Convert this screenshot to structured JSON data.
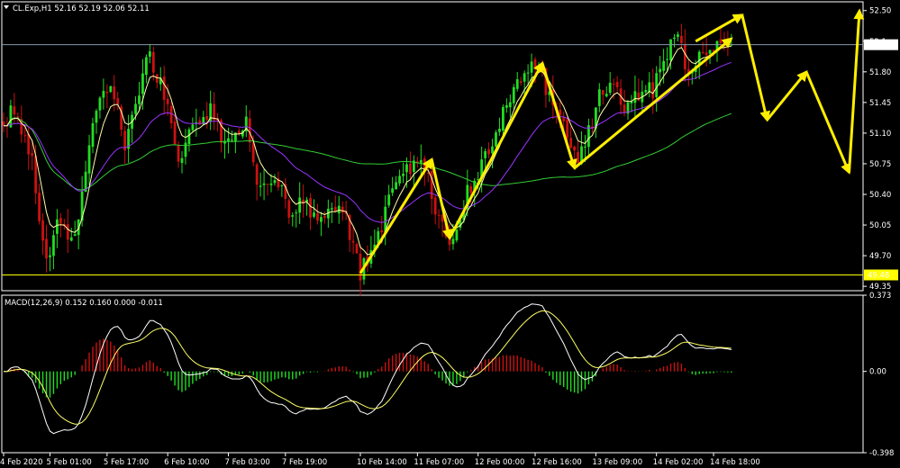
{
  "header": {
    "symbol": "CL.Exp,H1",
    "ohlc": "52.16 52.19 52.06 52.11",
    "macd_label": "MACD(12,26,9) 0.152 0.160 0.000 -0.011"
  },
  "price_axis": {
    "ticks": [
      52.5,
      52.15,
      51.8,
      51.45,
      51.1,
      50.75,
      50.4,
      50.05,
      49.7,
      49.35
    ],
    "tick_labels": [
      "52.50",
      "52.1",
      "51.80",
      "51.45",
      "51.10",
      "50.75",
      "50.40",
      "50.05",
      "49.70",
      "49.35"
    ],
    "current_price": 52.11,
    "current_label": "52.11",
    "support_price": 49.48,
    "support_label": "49.48",
    "ylim": [
      49.3,
      52.6
    ]
  },
  "macd_axis": {
    "ticks": [
      0.373,
      0.0,
      -0.398
    ],
    "tick_labels": [
      "0.373",
      "0.00",
      "-0.398"
    ],
    "ylim": [
      -0.398,
      0.373
    ]
  },
  "time_axis": {
    "labels": [
      "4 Feb 2020",
      "5 Feb 01:00",
      "5 Feb 17:00",
      "6 Feb 10:00",
      "7 Feb 03:00",
      "7 Feb 19:00",
      "10 Feb 14:00",
      "11 Feb 07:00",
      "12 Feb 00:00",
      "12 Feb 16:00",
      "13 Feb 09:00",
      "14 Feb 02:00",
      "14 Feb 18:00"
    ],
    "label_bars": [
      0,
      13,
      29,
      46,
      63,
      79,
      100,
      116,
      133,
      149,
      166,
      183,
      199
    ]
  },
  "colors": {
    "bull": "#22dd22",
    "bear": "#cc1111",
    "ma_fast": "#ffffaa",
    "ma_mid": "#9933ff",
    "ma_slow": "#33cc33",
    "macd_line": "#ffffff",
    "signal_line": "#ffff66",
    "arrows": "#ffee00",
    "support": "#ffff00",
    "current_line": "#8899aa"
  },
  "chart_data": {
    "type": "candlestick",
    "timeframe": "H1",
    "bars": 205,
    "anchors": [
      [
        0,
        51.2
      ],
      [
        3,
        51.4
      ],
      [
        8,
        50.8
      ],
      [
        12,
        49.6
      ],
      [
        15,
        50.1
      ],
      [
        20,
        49.9
      ],
      [
        25,
        51.2
      ],
      [
        30,
        51.7
      ],
      [
        34,
        51.0
      ],
      [
        38,
        51.6
      ],
      [
        41,
        52.0
      ],
      [
        46,
        51.4
      ],
      [
        49,
        50.8
      ],
      [
        54,
        51.2
      ],
      [
        58,
        51.4
      ],
      [
        62,
        51.0
      ],
      [
        68,
        51.2
      ],
      [
        72,
        50.4
      ],
      [
        76,
        50.6
      ],
      [
        80,
        50.2
      ],
      [
        84,
        50.4
      ],
      [
        88,
        50.0
      ],
      [
        92,
        50.3
      ],
      [
        96,
        50.1
      ],
      [
        100,
        49.5
      ],
      [
        104,
        49.8
      ],
      [
        108,
        50.3
      ],
      [
        112,
        50.6
      ],
      [
        117,
        50.9
      ],
      [
        122,
        50.1
      ],
      [
        125,
        49.9
      ],
      [
        128,
        50.2
      ],
      [
        132,
        50.6
      ],
      [
        136,
        50.9
      ],
      [
        141,
        51.4
      ],
      [
        146,
        51.8
      ],
      [
        150,
        51.9
      ],
      [
        153,
        51.5
      ],
      [
        157,
        51.2
      ],
      [
        160,
        50.8
      ],
      [
        163,
        51.0
      ],
      [
        167,
        51.5
      ],
      [
        170,
        51.7
      ],
      [
        174,
        51.4
      ],
      [
        178,
        51.5
      ],
      [
        182,
        51.6
      ],
      [
        186,
        52.0
      ],
      [
        189,
        52.2
      ],
      [
        192,
        51.8
      ],
      [
        196,
        52.1
      ],
      [
        201,
        52.05
      ],
      [
        205,
        52.11
      ]
    ],
    "forecast_path": [
      [
        194,
        52.15
      ],
      [
        207,
        52.45
      ],
      [
        214,
        51.25
      ],
      [
        225,
        51.8
      ],
      [
        237,
        50.65
      ],
      [
        250,
        52.5
      ]
    ],
    "trend_arrows": [
      [
        [
          100,
          49.5
        ],
        [
          120,
          50.8
        ]
      ],
      [
        [
          120,
          50.8
        ],
        [
          125,
          49.9
        ]
      ],
      [
        [
          125,
          49.9
        ],
        [
          151,
          51.9
        ]
      ],
      [
        [
          151,
          51.9
        ],
        [
          160,
          50.7
        ]
      ],
      [
        [
          160,
          50.7
        ],
        [
          204,
          52.18
        ]
      ]
    ],
    "moving_averages": [
      "ma_fast",
      "ma_mid",
      "ma_slow"
    ],
    "macd": {
      "fast": 12,
      "slow": 26,
      "signal": 9,
      "main": 0.152,
      "signal_value": 0.16,
      "histogram": -0.011
    }
  }
}
